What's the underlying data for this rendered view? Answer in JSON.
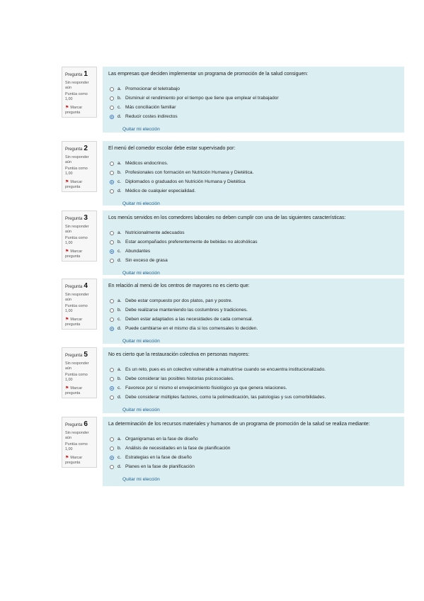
{
  "questions": [
    {
      "label": "Pregunta",
      "number": "1",
      "status": "Sin responder aún",
      "score": "Puntúa como 1,00",
      "flag": "Marcar pregunta",
      "text": "Las empresas que deciden implementar un programa de promoción de la salud consiguen:",
      "options": [
        {
          "letter": "a.",
          "text": "Promocionar el teletrabajo",
          "selected": false
        },
        {
          "letter": "b.",
          "text": "Disminuir el rendimiento por el tiempo que tiene que emplear el trabajador",
          "selected": false
        },
        {
          "letter": "c.",
          "text": "Más conciliación familiar",
          "selected": false
        },
        {
          "letter": "d.",
          "text": "Reducir costes indirectos",
          "selected": true
        }
      ],
      "clear_label": "Quitar mi elección"
    },
    {
      "label": "Pregunta",
      "number": "2",
      "status": "Sin responder aún",
      "score": "Puntúa como 1,00",
      "flag": "Marcar pregunta",
      "text": "El menú del comedor escolar debe estar supervisado por:",
      "options": [
        {
          "letter": "a.",
          "text": "Médicos endocrinos.",
          "selected": false
        },
        {
          "letter": "b.",
          "text": "Profesionales con formación en Nutrición Humana y Dietética.",
          "selected": false
        },
        {
          "letter": "c.",
          "text": "Diplomados o graduados en Nutrición Humana y Dietética",
          "selected": true
        },
        {
          "letter": "d.",
          "text": "Médico de cualquier especialidad.",
          "selected": false
        }
      ],
      "clear_label": "Quitar mi elección"
    },
    {
      "label": "Pregunta",
      "number": "3",
      "status": "Sin responder aún",
      "score": "Puntúa como 1,00",
      "flag": "Marcar pregunta",
      "text": "Los menús servidos en los comedores laborales no deben cumplir con una de las siguientes características:",
      "options": [
        {
          "letter": "a.",
          "text": "Nutricionalmente adecuados",
          "selected": false
        },
        {
          "letter": "b.",
          "text": "Estar acompañados preferentemente de bebidas no alcohólicas",
          "selected": false
        },
        {
          "letter": "c.",
          "text": "Abundantes",
          "selected": true
        },
        {
          "letter": "d.",
          "text": "Sin exceso de grasa",
          "selected": false
        }
      ],
      "clear_label": "Quitar mi elección"
    },
    {
      "label": "Pregunta",
      "number": "4",
      "status": "Sin responder aún",
      "score": "Puntúa como 1,00",
      "flag": "Marcar pregunta",
      "text": "En relación al menú de los centros de mayores no es cierto que:",
      "options": [
        {
          "letter": "a.",
          "text": "Debe estar compuesto por dos platos, pan y postre.",
          "selected": false
        },
        {
          "letter": "b.",
          "text": "Debe realizarse manteniendo las costumbres y tradiciones.",
          "selected": false
        },
        {
          "letter": "c.",
          "text": "Deben estar adaptados a las necesidades de cada comensal.",
          "selected": false
        },
        {
          "letter": "d.",
          "text": "Puede cambiarse en el mismo día si los comensales lo deciden.",
          "selected": true
        }
      ],
      "clear_label": "Quitar mi elección"
    },
    {
      "label": "Pregunta",
      "number": "5",
      "status": "Sin responder aún",
      "score": "Puntúa como 1,00",
      "flag": "Marcar pregunta",
      "text": "No es cierto que la restauración colectiva en personas mayores:",
      "options": [
        {
          "letter": "a.",
          "text": "Es un reto, pues es un colectivo vulnerable a malnutrirse cuando se encuentra institucionalizado.",
          "selected": false
        },
        {
          "letter": "b.",
          "text": "Debe considerar las posibles historias psicosociales.",
          "selected": false
        },
        {
          "letter": "c.",
          "text": "Favorece por sí mismo el envejecimiento fisiológico ya que genera relaciones.",
          "selected": true
        },
        {
          "letter": "d.",
          "text": "Debe considerar múltiples factores, como la polimedicación, las patologías y sus comorbilidades.",
          "selected": false
        }
      ],
      "clear_label": "Quitar mi elección"
    },
    {
      "label": "Pregunta",
      "number": "6",
      "status": "Sin responder aún",
      "score": "Puntúa como 1,00",
      "flag": "Marcar pregunta",
      "text": "La determinación de los recursos materiales y humanos de un programa de promoción de la salud se realiza mediante:",
      "options": [
        {
          "letter": "a.",
          "text": "Organigramas en la fase de diseño",
          "selected": false
        },
        {
          "letter": "b.",
          "text": "Análisis de necesidades en la fase de planificación",
          "selected": false
        },
        {
          "letter": "c.",
          "text": "Estrategias en la fase de diseño",
          "selected": true
        },
        {
          "letter": "d.",
          "text": "Planes en la fase de planificación",
          "selected": false
        }
      ],
      "clear_label": "Quitar mi elección"
    }
  ]
}
